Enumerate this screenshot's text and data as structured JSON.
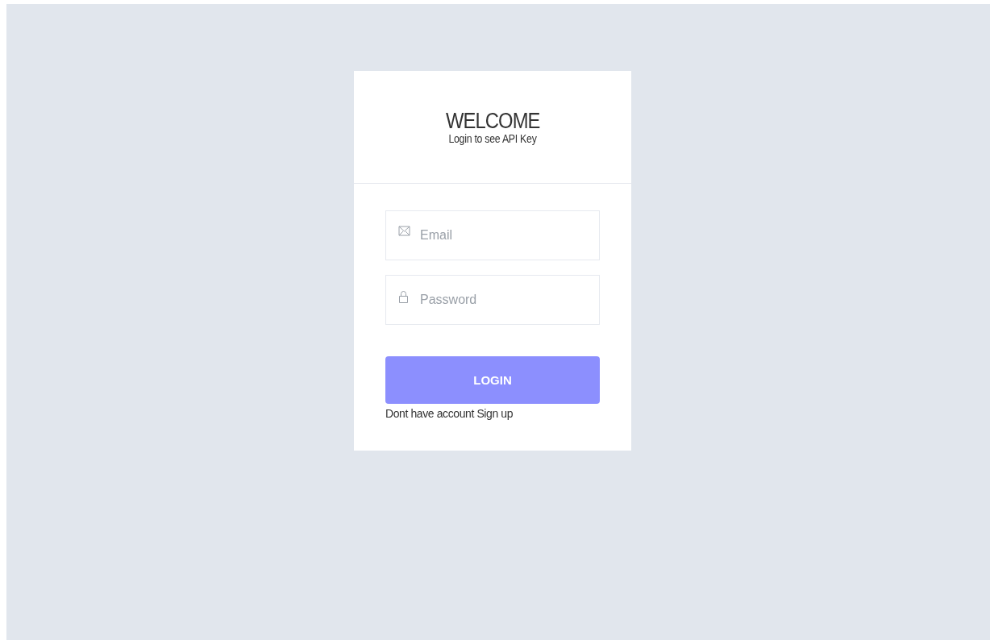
{
  "header": {
    "title": "WELCOME",
    "subtitle": "Login to see API Key"
  },
  "fields": [
    {
      "kind": "email",
      "placeholder": "Email"
    },
    {
      "kind": "password",
      "placeholder": "Password"
    }
  ],
  "login_button": "LOGIN",
  "signup_text": "Dont have account Sign up"
}
